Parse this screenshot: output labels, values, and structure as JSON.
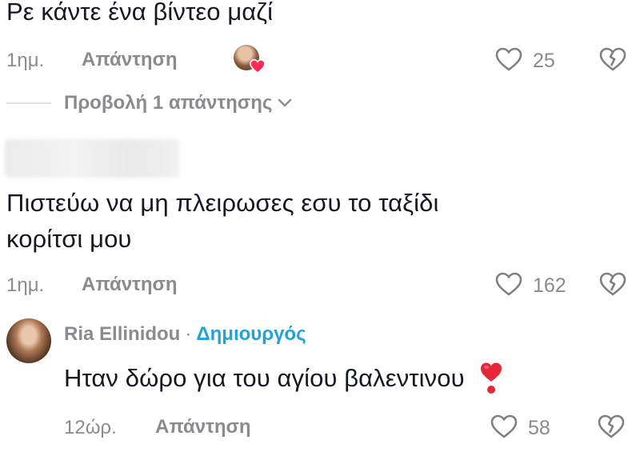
{
  "comments": [
    {
      "text": "Ρε κάντε ένα βίντεο μαζί",
      "time": "1ημ.",
      "reply_label": "Απάντηση",
      "likes": "25",
      "view_replies": "Προβολή 1 απάντησης"
    },
    {
      "author_blurred": true,
      "text_line1": "Πιστεύω να μη πλειρωσες εσυ το ταξίδι",
      "text_line2": "κορίτσι μου",
      "time": "1ημ.",
      "reply_label": "Απάντηση",
      "likes": "162"
    }
  ],
  "reply": {
    "author": "Ria Ellinidou",
    "separator": "·",
    "badge": "Δημιουργός",
    "text": "Ηταν δώρο για του αγίου βαλεντινου",
    "emoji": "❣️",
    "time": "12ώρ.",
    "reply_label": "Απάντηση",
    "likes": "58"
  },
  "icons": {
    "like": "heart-outline-icon",
    "dislike": "broken-heart-icon",
    "expand": "chevron-down-icon",
    "creator_liked": "heart-filled-icon"
  },
  "colors": {
    "text": "#161823",
    "muted": "#8a8b91",
    "creator_badge": "#20a4d8",
    "heart": "#fe2c55"
  }
}
